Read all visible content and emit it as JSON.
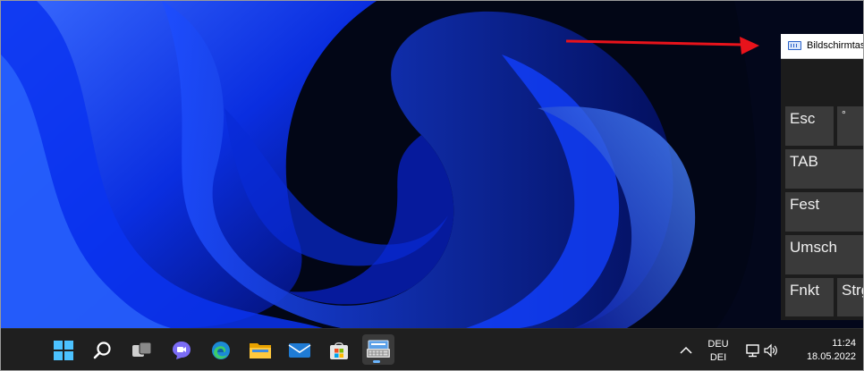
{
  "osk": {
    "title": "Bildschirmtastatur",
    "keys": [
      {
        "label": "Esc"
      },
      {
        "label": "°"
      },
      {
        "label": "TAB"
      },
      {
        "label": "Fest"
      },
      {
        "label": "Umsch"
      },
      {
        "label": "Fnkt"
      },
      {
        "label": "Strg"
      }
    ]
  },
  "taskbar": {
    "icons": [
      {
        "name": "start-icon"
      },
      {
        "name": "search-icon"
      },
      {
        "name": "task-view-icon"
      },
      {
        "name": "chat-icon"
      },
      {
        "name": "edge-icon"
      },
      {
        "name": "file-explorer-icon"
      },
      {
        "name": "mail-icon"
      },
      {
        "name": "store-icon"
      },
      {
        "name": "on-screen-keyboard-icon"
      }
    ],
    "tray": {
      "chevron": "^",
      "language_top": "DEU",
      "language_bottom": "DEI",
      "time": "11:24",
      "date": "18.05.2022"
    }
  },
  "colors": {
    "arrow": "#e8131b",
    "taskbar_bg": "#1f1f1f",
    "osk_bg": "#1c1c1c",
    "key_bg": "#3a3a3a",
    "active_indicator": "#6cb6ff"
  }
}
